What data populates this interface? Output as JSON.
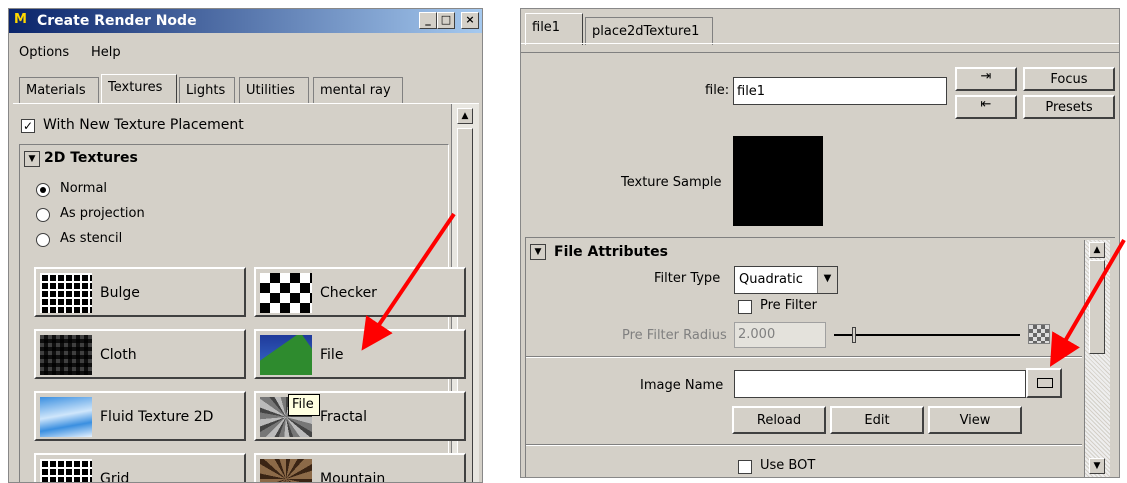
{
  "create_render_node": {
    "title": "Create Render Node",
    "menu": [
      "Options",
      "Help"
    ],
    "tabs": [
      "Materials",
      "Textures",
      "Lights",
      "Utilities",
      "mental ray"
    ],
    "active_tab": "Textures",
    "with_new_texture_placement": "With New Texture Placement",
    "section_title": "2D Textures",
    "radios": [
      "Normal",
      "As projection",
      "As stencil"
    ],
    "nodes": {
      "bulge": "Bulge",
      "checker": "Checker",
      "cloth": "Cloth",
      "file": "File",
      "fluid": "Fluid Texture 2D",
      "fractal": "Fractal",
      "grid": "Grid",
      "mountain": "Mountain"
    },
    "tooltip": "File"
  },
  "attribute_editor": {
    "tabs": [
      "file1",
      "place2dTexture1"
    ],
    "file_label": "file:",
    "file_value": "file1",
    "focus": "Focus",
    "presets": "Presets",
    "texture_sample_label": "Texture Sample",
    "section_title": "File Attributes",
    "filter_type_label": "Filter Type",
    "filter_type_value": "Quadratic",
    "pre_filter_label": "Pre Filter",
    "pre_filter_radius_label": "Pre Filter Radius",
    "pre_filter_radius_value": "2.000",
    "image_name_label": "Image Name",
    "image_name_value": "",
    "reload": "Reload",
    "edit": "Edit",
    "view": "View",
    "use_bot": "Use BOT"
  },
  "colors": {
    "title_active": "#0a246a",
    "panel": "#d4d0c8",
    "arrow": "#ff0000"
  }
}
